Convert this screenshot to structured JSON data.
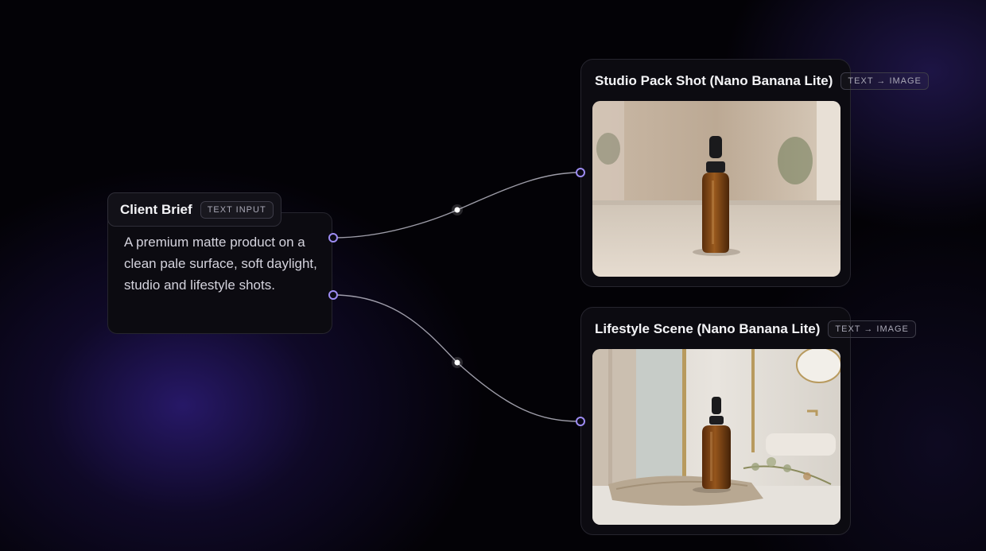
{
  "canvas": {
    "accent_color": "#9d8cf2",
    "background_color": "#030206",
    "nodes": [
      {
        "id": "client-brief",
        "title": "Client Brief",
        "badge": "TEXT INPUT",
        "text": "A premium matte product on a clean pale surface, soft daylight, studio and lifestyle shots."
      },
      {
        "id": "studio-pack-shot",
        "title": "Studio Pack Shot (Nano Banana Lite)",
        "badge": "TEXT → IMAGE",
        "image": "amber dropper bottle on stone surface, studio"
      },
      {
        "id": "lifestyle-scene",
        "title": "Lifestyle Scene (Nano Banana Lite)",
        "badge": "TEXT → IMAGE",
        "image": "amber dropper bottle on linen in bathroom, lifestyle"
      }
    ],
    "edges": [
      {
        "from": "client-brief",
        "to": "studio-pack-shot"
      },
      {
        "from": "client-brief",
        "to": "lifestyle-scene"
      }
    ]
  }
}
